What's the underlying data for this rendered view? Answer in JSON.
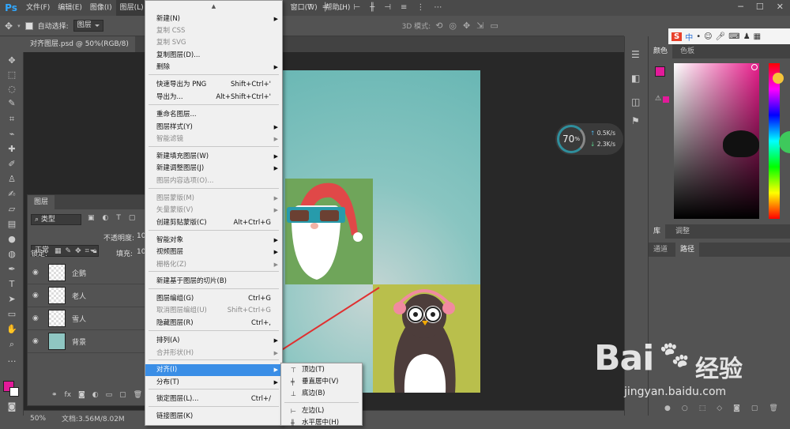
{
  "app": {
    "logo": "Ps"
  },
  "menubar": {
    "items": [
      "文件(F)",
      "编辑(E)",
      "图像(I)",
      "图层(L)",
      "窗口(W)",
      "帮助(H)"
    ]
  },
  "options": {
    "auto_select_label": "自动选择:",
    "auto_select_value": "图层",
    "mode_3d": "3D 模式:"
  },
  "document": {
    "tab_title": "对齐图层.psd @ 50%(RGB/8)"
  },
  "layers_panel": {
    "tab": "图层",
    "filter": "类型",
    "blend_mode": "正常",
    "opacity_label": "不透明度:",
    "opacity_value": "10",
    "lock_label": "锁定:",
    "fill_label": "填充:",
    "fill_value": "10",
    "layers": [
      {
        "name": "企鹅"
      },
      {
        "name": "老人"
      },
      {
        "name": "雪人"
      },
      {
        "name": "背景"
      }
    ]
  },
  "layer_menu": {
    "items": [
      {
        "label": "新建(N)",
        "shortcut": "",
        "submenu": true,
        "disabled": false
      },
      {
        "label": "复制 CSS",
        "shortcut": "",
        "submenu": false,
        "disabled": true
      },
      {
        "label": "复制 SVG",
        "shortcut": "",
        "submenu": false,
        "disabled": true
      },
      {
        "label": "复制图层(D)...",
        "shortcut": "",
        "submenu": false,
        "disabled": false
      },
      {
        "label": "删除",
        "shortcut": "",
        "submenu": true,
        "disabled": false
      },
      {
        "label": "快速导出为 PNG",
        "shortcut": "Shift+Ctrl+'",
        "submenu": false,
        "disabled": false
      },
      {
        "label": "导出为...",
        "shortcut": "Alt+Shift+Ctrl+'",
        "submenu": false,
        "disabled": false
      },
      {
        "label": "重命名图层...",
        "shortcut": "",
        "submenu": false,
        "disabled": false
      },
      {
        "label": "图层样式(Y)",
        "shortcut": "",
        "submenu": true,
        "disabled": false
      },
      {
        "label": "智能滤镜",
        "shortcut": "",
        "submenu": true,
        "disabled": true
      },
      {
        "label": "新建填充图层(W)",
        "shortcut": "",
        "submenu": true,
        "disabled": false
      },
      {
        "label": "新建调整图层(J)",
        "shortcut": "",
        "submenu": true,
        "disabled": false
      },
      {
        "label": "图层内容选项(O)...",
        "shortcut": "",
        "submenu": false,
        "disabled": true
      },
      {
        "label": "图层蒙版(M)",
        "shortcut": "",
        "submenu": true,
        "disabled": true
      },
      {
        "label": "矢量蒙版(V)",
        "shortcut": "",
        "submenu": true,
        "disabled": true
      },
      {
        "label": "创建剪贴蒙版(C)",
        "shortcut": "Alt+Ctrl+G",
        "submenu": false,
        "disabled": false
      },
      {
        "label": "智能对象",
        "shortcut": "",
        "submenu": true,
        "disabled": false
      },
      {
        "label": "视频图层",
        "shortcut": "",
        "submenu": true,
        "disabled": false
      },
      {
        "label": "栅格化(Z)",
        "shortcut": "",
        "submenu": true,
        "disabled": true
      },
      {
        "label": "新建基于图层的切片(B)",
        "shortcut": "",
        "submenu": false,
        "disabled": false
      },
      {
        "label": "图层编组(G)",
        "shortcut": "Ctrl+G",
        "submenu": false,
        "disabled": false
      },
      {
        "label": "取消图层编组(U)",
        "shortcut": "Shift+Ctrl+G",
        "submenu": false,
        "disabled": true
      },
      {
        "label": "隐藏图层(R)",
        "shortcut": "Ctrl+,",
        "submenu": false,
        "disabled": false
      },
      {
        "label": "排列(A)",
        "shortcut": "",
        "submenu": true,
        "disabled": false
      },
      {
        "label": "合并形状(H)",
        "shortcut": "",
        "submenu": true,
        "disabled": true
      },
      {
        "label": "对齐(I)",
        "shortcut": "",
        "submenu": true,
        "disabled": false
      },
      {
        "label": "分布(T)",
        "shortcut": "",
        "submenu": true,
        "disabled": false
      },
      {
        "label": "锁定图层(L)...",
        "shortcut": "Ctrl+/",
        "submenu": false,
        "disabled": false
      },
      {
        "label": "链接图层(K)",
        "shortcut": "",
        "submenu": false,
        "disabled": false
      }
    ]
  },
  "align_submenu": {
    "items": [
      "顶边(T)",
      "垂直居中(V)",
      "底边(B)",
      "左边(L)",
      "水平居中(H)"
    ]
  },
  "right_panel": {
    "tabs_top": [
      "颜色",
      "色板"
    ],
    "tabs_mid": [
      "库",
      "调整"
    ],
    "tabs_bottom": [
      "通道",
      "路径"
    ],
    "foreground_color": "#e31a9a"
  },
  "status": {
    "zoom": "50%",
    "doc_info": "文档:3.56M/8.02M"
  },
  "speed_widget": {
    "percent": "70",
    "unit": "%",
    "up": "0.5",
    "down": "2.3",
    "rate_unit": "K/s"
  },
  "ime": {
    "logo": "S",
    "label": "中"
  },
  "watermark": {
    "brand": "Bai",
    "brand2": "经验",
    "url": "jingyan.baidu.com"
  }
}
